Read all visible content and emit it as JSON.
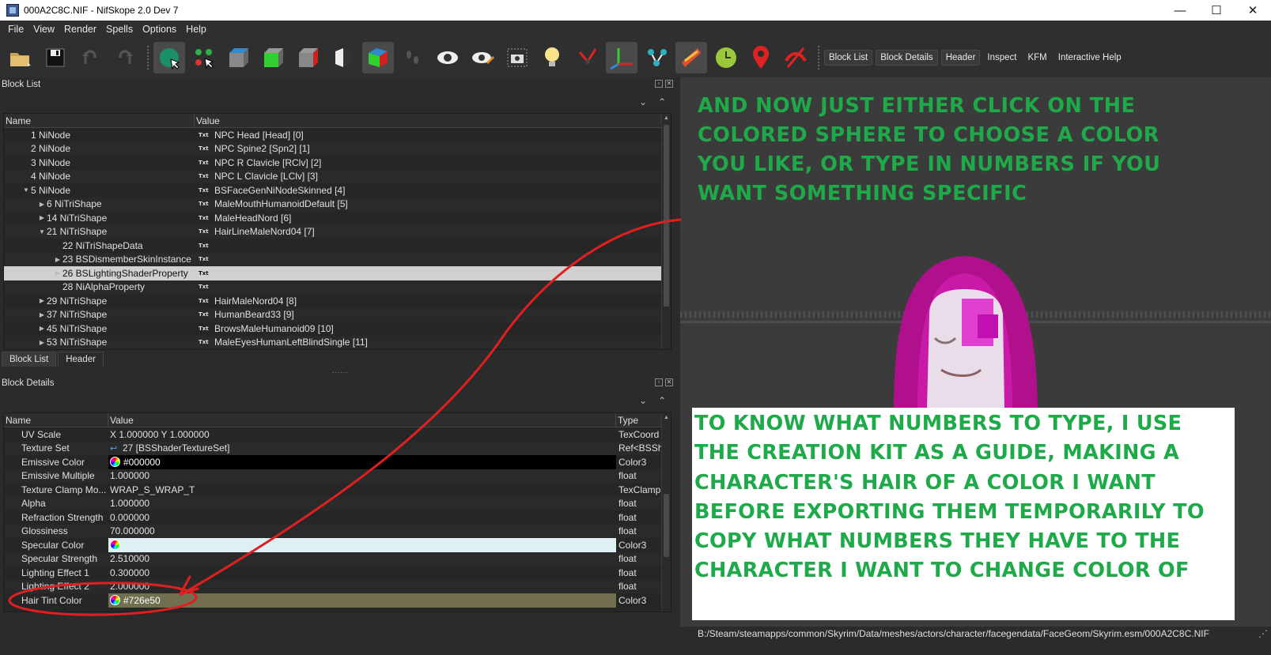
{
  "window": {
    "title": "000A2C8C.NIF - NifSkope 2.0 Dev 7",
    "minimize": "—",
    "maximize": "☐",
    "close": "✕"
  },
  "menu": [
    "File",
    "View",
    "Render",
    "Spells",
    "Options",
    "Help"
  ],
  "toolbar": {
    "text_buttons": [
      "Block List",
      "Block Details",
      "Header",
      "Inspect",
      "KFM",
      "Interactive Help"
    ]
  },
  "block_list": {
    "title": "Block List",
    "columns": [
      "Name",
      "Value"
    ],
    "rows": [
      {
        "name": "1 NiNode",
        "value": "NPC Head [Head] [0]",
        "indent": 0,
        "arrow": ""
      },
      {
        "name": "2 NiNode",
        "value": "NPC Spine2 [Spn2] [1]",
        "indent": 0,
        "arrow": ""
      },
      {
        "name": "3 NiNode",
        "value": "NPC R Clavicle [RClv] [2]",
        "indent": 0,
        "arrow": ""
      },
      {
        "name": "4 NiNode",
        "value": "NPC L Clavicle [LClv] [3]",
        "indent": 0,
        "arrow": ""
      },
      {
        "name": "5 NiNode",
        "value": "BSFaceGenNiNodeSkinned [4]",
        "indent": 0,
        "arrow": "▼"
      },
      {
        "name": "6 NiTriShape",
        "value": "MaleMouthHumanoidDefault [5]",
        "indent": 1,
        "arrow": "▶"
      },
      {
        "name": "14 NiTriShape",
        "value": "MaleHeadNord [6]",
        "indent": 1,
        "arrow": "▶"
      },
      {
        "name": "21 NiTriShape",
        "value": "HairLineMaleNord04 [7]",
        "indent": 1,
        "arrow": "▼"
      },
      {
        "name": "22 NiTriShapeData",
        "value": "",
        "indent": 2,
        "arrow": ""
      },
      {
        "name": "23 BSDismemberSkinInstance",
        "value": "",
        "indent": 2,
        "arrow": "▶"
      },
      {
        "name": "26 BSLightingShaderProperty",
        "value": "",
        "indent": 2,
        "arrow": "▶"
      },
      {
        "name": "28 NiAlphaProperty",
        "value": "",
        "indent": 2,
        "arrow": ""
      },
      {
        "name": "29 NiTriShape",
        "value": "HairMaleNord04 [8]",
        "indent": 1,
        "arrow": "▶"
      },
      {
        "name": "37 NiTriShape",
        "value": "HumanBeard33 [9]",
        "indent": 1,
        "arrow": "▶"
      },
      {
        "name": "45 NiTriShape",
        "value": "BrowsMaleHumanoid09 [10]",
        "indent": 1,
        "arrow": "▶"
      },
      {
        "name": "53 NiTriShape",
        "value": "MaleEyesHumanLeftBlindSingle [11]",
        "indent": 1,
        "arrow": "▶"
      }
    ],
    "selected_index": 10,
    "txt_label": "Txt",
    "tabs": [
      "Block List",
      "Header"
    ]
  },
  "block_details": {
    "title": "Block Details",
    "columns": [
      "Name",
      "Value",
      "Type"
    ],
    "rows": [
      {
        "name": "UV Scale",
        "value": "X 1.000000 Y 1.000000",
        "type": "TexCoord",
        "icon": ""
      },
      {
        "name": "Texture Set",
        "value": "27 [BSShaderTextureSet]",
        "type": "Ref<BSSha",
        "icon": "link"
      },
      {
        "name": "Emissive Color",
        "value": "#000000",
        "type": "Color3",
        "icon": "wheel",
        "bg": "#000000",
        "fg": "#ffffff"
      },
      {
        "name": "Emissive Multiple",
        "value": "1.000000",
        "type": "float",
        "icon": ""
      },
      {
        "name": "Texture Clamp Mo...",
        "value": "WRAP_S_WRAP_T",
        "type": "TexClampM",
        "icon": ""
      },
      {
        "name": "Alpha",
        "value": "1.000000",
        "type": "float",
        "icon": ""
      },
      {
        "name": "Refraction Strength",
        "value": "0.000000",
        "type": "float",
        "icon": ""
      },
      {
        "name": "Glossiness",
        "value": "70.000000",
        "type": "float",
        "icon": ""
      },
      {
        "name": "Specular Color",
        "value": "#dff0f4",
        "type": "Color3",
        "icon": "wheel",
        "bg": "#dff0f4",
        "fg": "#dff0f4"
      },
      {
        "name": "Specular Strength",
        "value": "2.510000",
        "type": "float",
        "icon": ""
      },
      {
        "name": "Lighting Effect 1",
        "value": "0.300000",
        "type": "float",
        "icon": ""
      },
      {
        "name": "Lighting Effect 2",
        "value": "2.000000",
        "type": "float",
        "icon": ""
      },
      {
        "name": "Hair Tint Color",
        "value": "#726e50",
        "type": "Color3",
        "icon": "wheel",
        "bg": "#726e50",
        "fg": "#ffffff"
      }
    ]
  },
  "viewport": {
    "note_top": "AND NOW JUST EITHER CLICK ON THE\nCOLORED SPHERE TO CHOOSE A COLOR\nYOU LIKE, OR TYPE IN NUMBERS IF YOU\nWANT SOMETHING SPECIFIC",
    "note_bottom": "TO KNOW WHAT NUMBERS TO TYPE, I USE\nTHE CREATION KIT AS A GUIDE, MAKING A\nCHARACTER'S HAIR OF A COLOR I WANT\nBEFORE EXPORTING THEM TEMPORARILY TO\nCOPY WHAT NUMBERS THEY HAVE TO THE\nCHARACTER I WANT TO CHANGE COLOR OF"
  },
  "status": {
    "path": "B:/Steam/steamapps/common/Skyrim/Data/meshes/actors/character/facegendata/FaceGeom/Skyrim.esm/000A2C8C.NIF"
  },
  "colors": {
    "overlay_green": "#1faa4a",
    "annotation_red": "#e02020",
    "hair_magenta": "#c0109a"
  }
}
